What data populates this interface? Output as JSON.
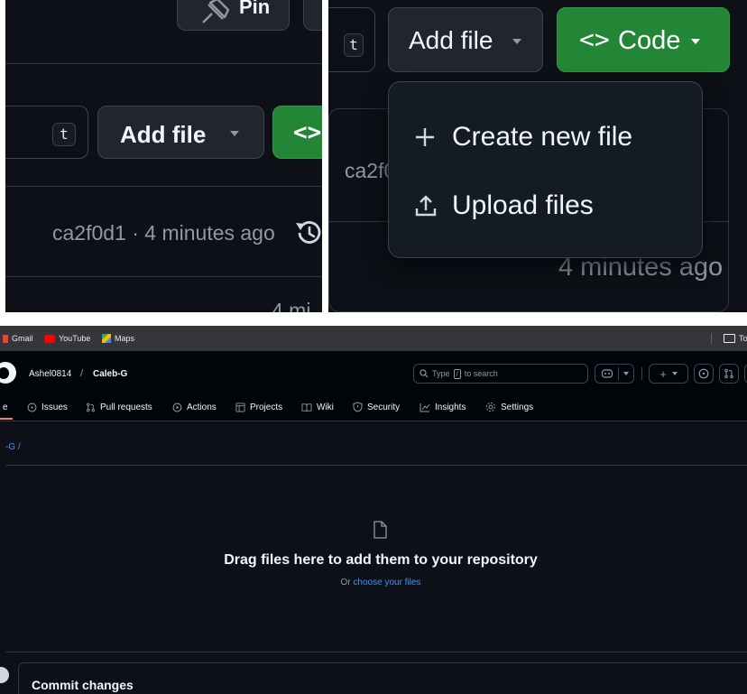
{
  "panel1": {
    "pin_label": "Pin",
    "t_key": "t",
    "add_file_label": "Add file",
    "code_icon_text": "<>",
    "commit_info": "ca2f0d1 · 4 minutes ago",
    "time_fragment": "4 mi"
  },
  "panel2": {
    "t_key": "t",
    "add_file_label": "Add file",
    "code_label": "Code",
    "code_icon_text": "<>",
    "commit_fragment": "ca2f0",
    "time_label": "4 minutes ago",
    "menu": {
      "create_new_file": "Create new file",
      "upload_files": "Upload files"
    }
  },
  "bookmarks": {
    "gmail": "Gmail",
    "youtube": "YouTube",
    "maps": "Maps",
    "folder_fragment": "To"
  },
  "header": {
    "owner": "Ashel0814",
    "separator": "/",
    "repo": "Caleb-G",
    "search_prefix": "Type",
    "search_key": "/",
    "search_suffix": "to search",
    "plus": "+"
  },
  "nav": {
    "code_fragment": "e",
    "issues": "Issues",
    "pull_requests": "Pull requests",
    "actions": "Actions",
    "projects": "Projects",
    "wiki": "Wiki",
    "security": "Security",
    "insights": "Insights",
    "settings": "Settings"
  },
  "breadcrumb": "-G /",
  "dropzone": {
    "title": "Drag files here to add them to your repository",
    "or_text": "Or",
    "choose_link": "choose your files"
  },
  "commit": {
    "title": "Commit changes"
  },
  "colors": {
    "bg": "#0d1117",
    "header_bg": "#010409",
    "green": "#238636",
    "link": "#4493f8",
    "border": "#30363d"
  }
}
